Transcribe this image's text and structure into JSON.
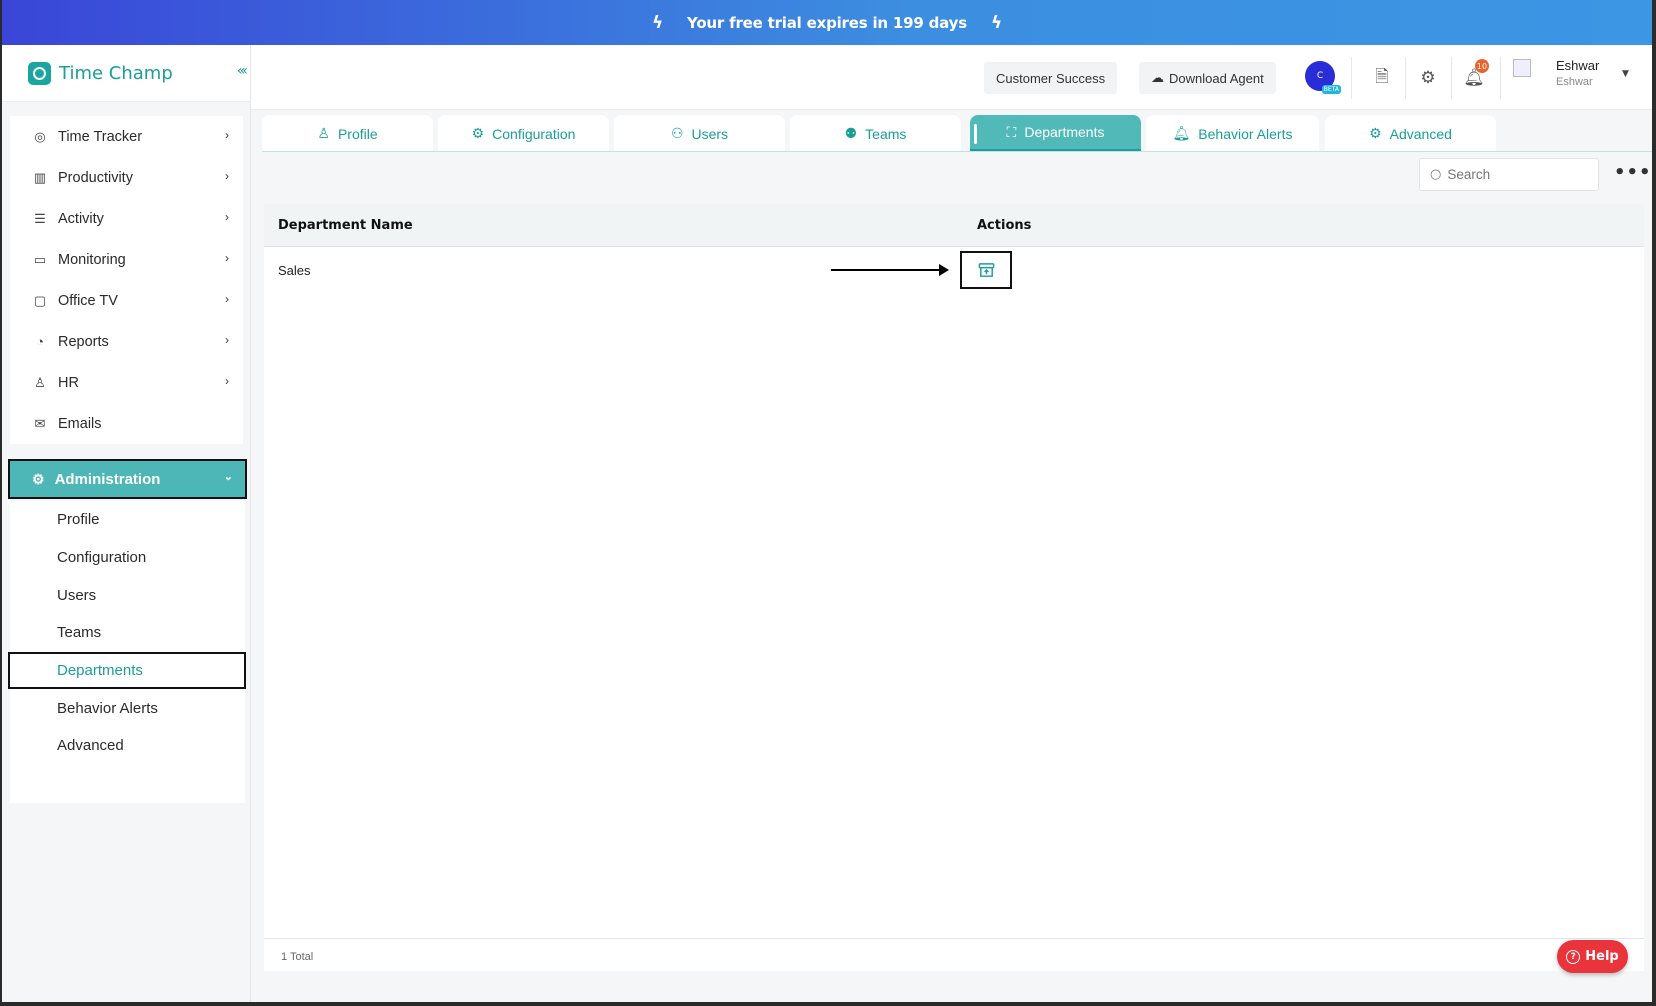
{
  "banner": {
    "text": "Your free trial expires in 199 days"
  },
  "brand": {
    "name": "Time Champ"
  },
  "sidebar": {
    "items": [
      {
        "label": "Time Tracker",
        "icon": "timer-icon"
      },
      {
        "label": "Productivity",
        "icon": "bar-chart-icon"
      },
      {
        "label": "Activity",
        "icon": "activity-icon"
      },
      {
        "label": "Monitoring",
        "icon": "monitor-icon"
      },
      {
        "label": "Office TV",
        "icon": "tv-icon"
      },
      {
        "label": "Reports",
        "icon": "pie-chart-icon"
      },
      {
        "label": "HR",
        "icon": "person-icon"
      },
      {
        "label": "Emails",
        "icon": "mail-icon"
      }
    ],
    "admin_label": "Administration",
    "sub_items": [
      {
        "label": "Profile"
      },
      {
        "label": "Configuration"
      },
      {
        "label": "Users"
      },
      {
        "label": "Teams"
      },
      {
        "label": "Departments",
        "active": true
      },
      {
        "label": "Behavior Alerts"
      },
      {
        "label": "Advanced"
      }
    ]
  },
  "header": {
    "customer_success": "Customer Success",
    "download_agent": "Download Agent",
    "notification_count": "10",
    "user_name": "Eshwar",
    "user_sub": "Eshwar"
  },
  "tabs": [
    {
      "label": "Profile"
    },
    {
      "label": "Configuration"
    },
    {
      "label": "Users"
    },
    {
      "label": "Teams"
    },
    {
      "label": "Departments",
      "active": true
    },
    {
      "label": "Behavior Alerts"
    },
    {
      "label": "Advanced"
    }
  ],
  "search": {
    "placeholder": "Search"
  },
  "table": {
    "columns": [
      "Department Name",
      "Actions"
    ],
    "rows": [
      {
        "name": "Sales"
      }
    ],
    "footer": "1 Total"
  },
  "help": {
    "label": "Help"
  },
  "colors": {
    "accent": "#1a9e98",
    "active_bg": "#52b9b9",
    "help": "#e8343a"
  }
}
